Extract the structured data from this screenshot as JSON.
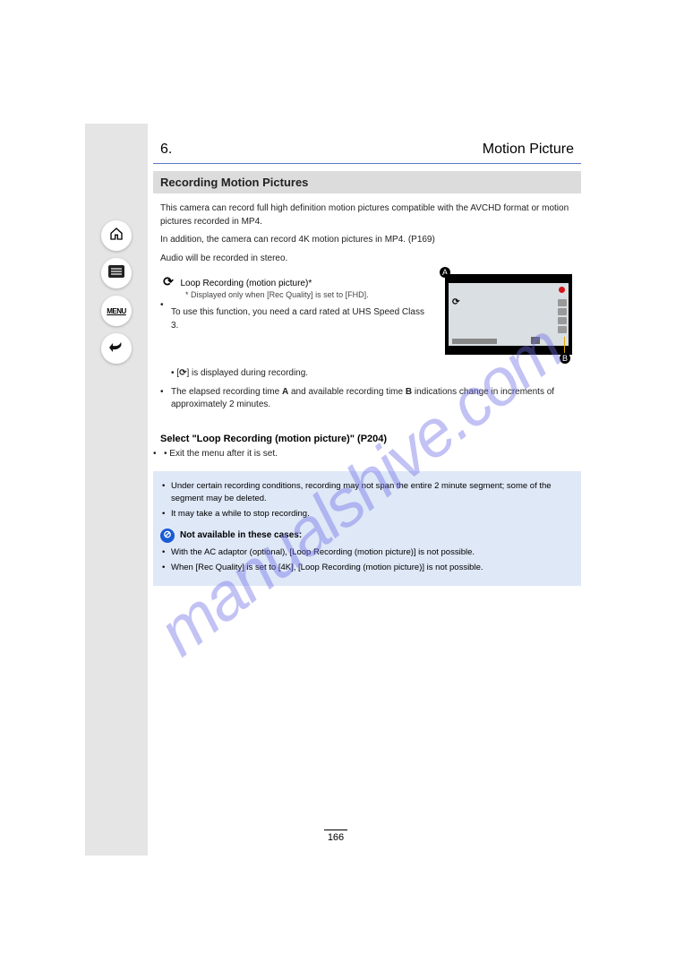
{
  "nav": {
    "menu_label": "MENU"
  },
  "header": {
    "chapter_num": "6.",
    "chapter_title": "Motion Picture"
  },
  "section_title": "Recording Motion Pictures",
  "section1": {
    "intro": "This camera can record full high definition motion pictures compatible with the AVCHD format or motion pictures recorded in MP4.",
    "intro2": "In addition, the camera can record 4K motion pictures in MP4.",
    "ref": "(P169)",
    "audio_line": "Audio will be recorded in stereo."
  },
  "loop": {
    "icon": "⟳",
    "label_a_text": "Loop Recording (motion picture)",
    "callout_a": "A",
    "callout_b": "B",
    "footnote_star": "*",
    "footnote_text": " Displayed only when [Rec Quality] is set to [FHD].",
    "below1_bullet": "To use this function, you need a card rated at UHS Speed Class 3.",
    "rec_point1": "• [",
    "rec_point1b": "] is displayed during recording.",
    "elapsed_a": "The elapsed recording time ",
    "elapsed_b": " and available recording time ",
    "elapsed_c": " indications change in increments of approximately 2 minutes."
  },
  "step_title": "Select \"Loop Recording (motion picture)\" (P204)",
  "sub_below": "• Exit the menu after it is set.",
  "notebox": {
    "line1a": "Under certain recording conditions, recording may not span the entire 2 minute segment; some of the segment may be deleted.",
    "line1b": "It may take a while to stop recording.",
    "na_label": "Not available in these cases:",
    "li1": "With the AC adaptor (optional), [Loop Recording (motion picture)] is not possible.",
    "li2": "When [Rec Quality] is set to [4K], [Loop Recording (motion picture)] is not possible."
  },
  "page_number": "166",
  "watermark": "manualshive.com"
}
